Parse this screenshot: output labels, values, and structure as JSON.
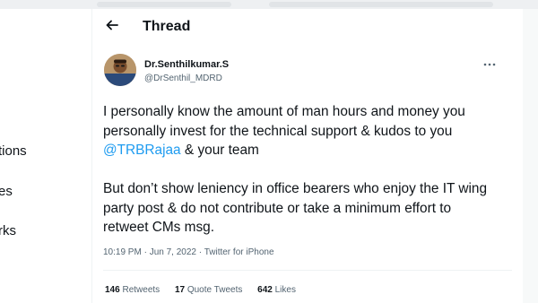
{
  "sidebar": {
    "items": [
      {
        "label": "tions"
      },
      {
        "label": "es"
      },
      {
        "label": "rks"
      }
    ]
  },
  "header": {
    "title": "Thread",
    "back_icon": "arrow-left-icon"
  },
  "tweet": {
    "author": {
      "name": "Dr.Senthilkumar.S",
      "handle": "@DrSenthil_MDRD"
    },
    "more_icon": "more-horizontal-icon",
    "body": {
      "p1_before": "I personally know the amount of man hours and money you personally invest for the technical support & kudos to you ",
      "mention": "@TRBRajaa",
      "p1_after": " & your team",
      "p2": "But don’t show leniency in office bearers who enjoy the IT wing party post & do not contribute or take a minimum effort to retweet CMs msg."
    },
    "meta": {
      "time": "10:19 PM",
      "separator": " · ",
      "date": "Jun 7, 2022",
      "source": "Twitter for iPhone"
    },
    "stats": {
      "retweets_count": "146",
      "retweets_label": "Retweets",
      "quotes_count": "17",
      "quotes_label": "Quote Tweets",
      "likes_count": "642",
      "likes_label": "Likes"
    }
  },
  "colors": {
    "accent": "#1d9bf0",
    "text_primary": "#0f1419",
    "text_secondary": "#536471",
    "border": "#eff3f4"
  }
}
